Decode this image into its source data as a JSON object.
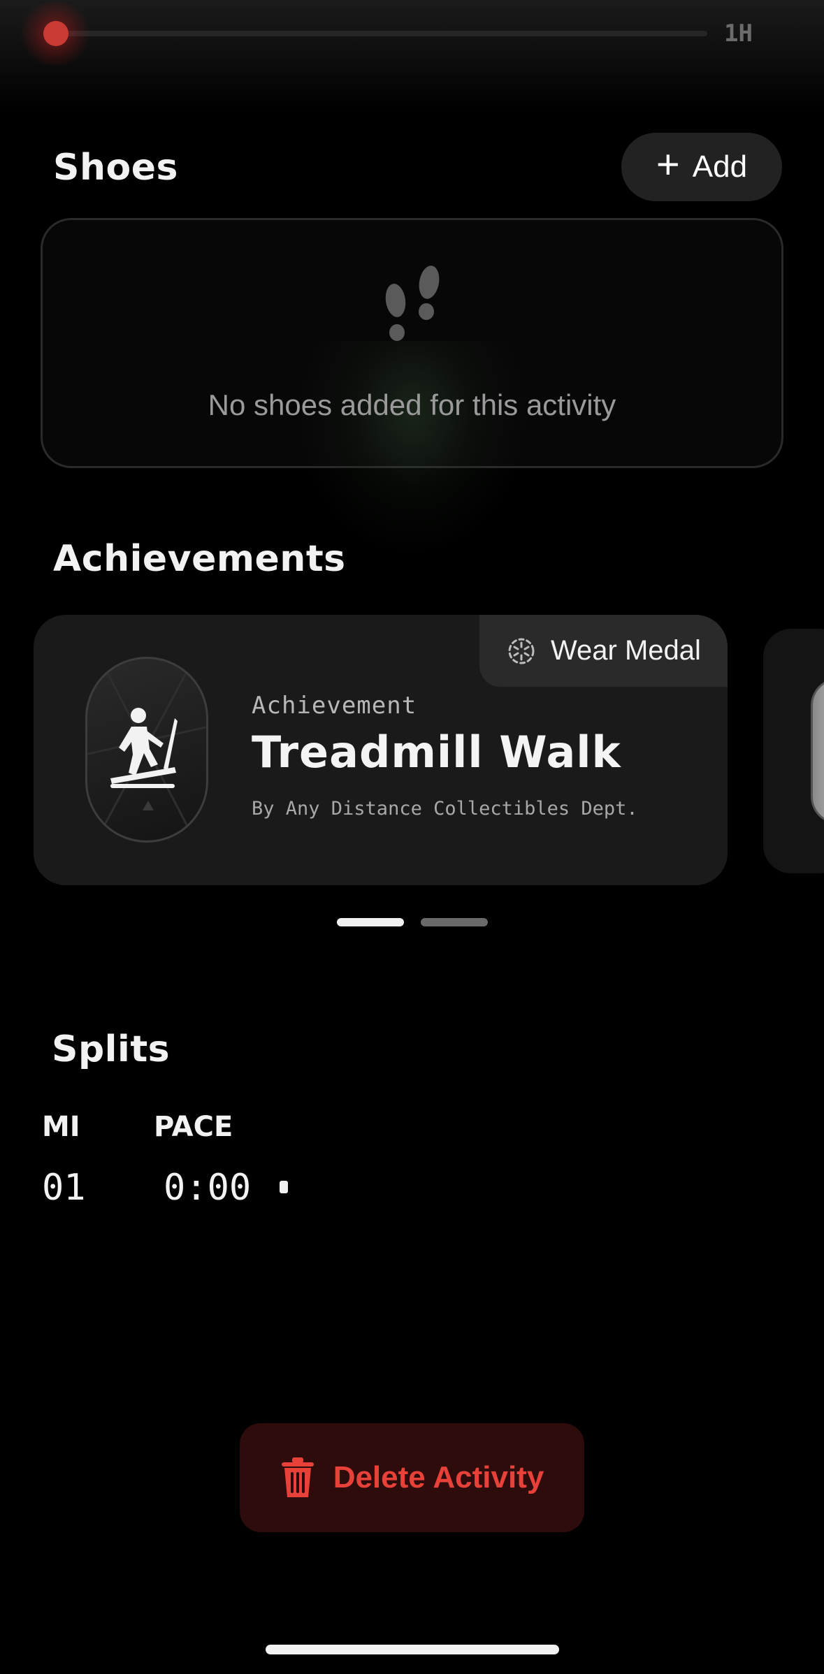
{
  "timeline": {
    "label": "1H",
    "progress": 0
  },
  "shoes": {
    "title": "Shoes",
    "add_label": "Add",
    "empty_message": "No shoes added for this activity"
  },
  "achievements": {
    "title": "Achievements",
    "card": {
      "action_label": "Wear Medal",
      "kicker": "Achievement",
      "title": "Treadmill Walk",
      "subtitle": "By Any Distance Collectibles Dept."
    },
    "page_count": 2,
    "active_page": 1
  },
  "splits": {
    "title": "Splits",
    "columns": [
      "MI",
      "PACE"
    ],
    "rows": [
      {
        "mi": "01",
        "pace": "0:00"
      }
    ]
  },
  "delete_label": "Delete Activity",
  "colors": {
    "background": "#000000",
    "accent_red": "#e8413a",
    "delete_bg": "#2e0c0c",
    "card": "#1a1a1a"
  }
}
